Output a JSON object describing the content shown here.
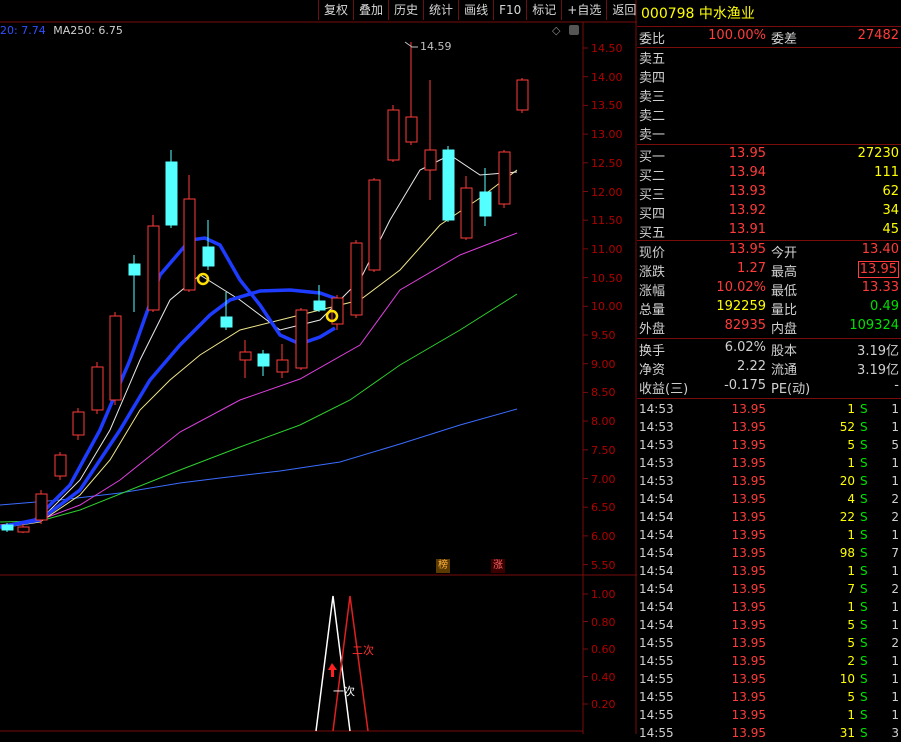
{
  "toolbar": [
    "复权",
    "叠加",
    "历史",
    "统计",
    "画线",
    "F10",
    "标记",
    "+自选",
    "返回"
  ],
  "indicator": {
    "ma_left": "20: 7.74",
    "ma250": "MA250: 6.75"
  },
  "price_axis": [
    "14.50",
    "14.00",
    "13.50",
    "13.00",
    "12.50",
    "12.00",
    "11.50",
    "11.00",
    "10.50",
    "10.00",
    "9.50",
    "9.00",
    "8.50",
    "8.00",
    "7.50",
    "7.00",
    "6.50",
    "6.00",
    "5.50"
  ],
  "peak_label": "14.59",
  "sub_axis": [
    "1.00",
    "0.80",
    "0.60",
    "0.40",
    "0.20"
  ],
  "badges": {
    "b1": "榜",
    "b2": "涨"
  },
  "signal_labels": {
    "first": "一次",
    "second": "二次"
  },
  "stock": {
    "code": "000798",
    "name": "中水渔业"
  },
  "weibi": {
    "label1": "委比",
    "value1": "100.00%",
    "label2": "委差",
    "value2": "27482"
  },
  "sell": [
    "卖五",
    "卖四",
    "卖三",
    "卖二",
    "卖一"
  ],
  "buy": [
    {
      "label": "买一",
      "price": "13.95",
      "vol": "27230"
    },
    {
      "label": "买二",
      "price": "13.94",
      "vol": "111"
    },
    {
      "label": "买三",
      "price": "13.93",
      "vol": "62"
    },
    {
      "label": "买四",
      "price": "13.92",
      "vol": "34"
    },
    {
      "label": "买五",
      "price": "13.91",
      "vol": "45"
    }
  ],
  "quote": [
    {
      "l1": "现价",
      "v1": "13.95",
      "l2": "今开",
      "v2": "13.40"
    },
    {
      "l1": "涨跌",
      "v1": "1.27",
      "l2": "最高",
      "v2": "13.95"
    },
    {
      "l1": "涨幅",
      "v1": "10.02%",
      "l2": "最低",
      "v2": "13.33"
    },
    {
      "l1": "总量",
      "v1": "192259",
      "l2": "量比",
      "v2": "0.49"
    },
    {
      "l1": "外盘",
      "v1": "82935",
      "l2": "内盘",
      "v2": "109324"
    }
  ],
  "fund": [
    {
      "l1": "换手",
      "v1": "6.02%",
      "l2": "股本",
      "v2": "3.19亿"
    },
    {
      "l1": "净资",
      "v1": "2.22",
      "l2": "流通",
      "v2": "3.19亿"
    },
    {
      "l1": "收益(三)",
      "v1": "-0.175",
      "l2": "PE(动)",
      "v2": "-"
    }
  ],
  "trades": [
    {
      "t": "14:53",
      "p": "13.95",
      "v": "1",
      "s": "S",
      "n": "1"
    },
    {
      "t": "14:53",
      "p": "13.95",
      "v": "52",
      "s": "S",
      "n": "1"
    },
    {
      "t": "14:53",
      "p": "13.95",
      "v": "5",
      "s": "S",
      "n": "5"
    },
    {
      "t": "14:53",
      "p": "13.95",
      "v": "1",
      "s": "S",
      "n": "1"
    },
    {
      "t": "14:53",
      "p": "13.95",
      "v": "20",
      "s": "S",
      "n": "1"
    },
    {
      "t": "14:54",
      "p": "13.95",
      "v": "4",
      "s": "S",
      "n": "2"
    },
    {
      "t": "14:54",
      "p": "13.95",
      "v": "22",
      "s": "S",
      "n": "2"
    },
    {
      "t": "14:54",
      "p": "13.95",
      "v": "1",
      "s": "S",
      "n": "1"
    },
    {
      "t": "14:54",
      "p": "13.95",
      "v": "98",
      "s": "S",
      "n": "7"
    },
    {
      "t": "14:54",
      "p": "13.95",
      "v": "1",
      "s": "S",
      "n": "1"
    },
    {
      "t": "14:54",
      "p": "13.95",
      "v": "7",
      "s": "S",
      "n": "2"
    },
    {
      "t": "14:54",
      "p": "13.95",
      "v": "1",
      "s": "S",
      "n": "1"
    },
    {
      "t": "14:54",
      "p": "13.95",
      "v": "5",
      "s": "S",
      "n": "1"
    },
    {
      "t": "14:55",
      "p": "13.95",
      "v": "5",
      "s": "S",
      "n": "2"
    },
    {
      "t": "14:55",
      "p": "13.95",
      "v": "2",
      "s": "S",
      "n": "1"
    },
    {
      "t": "14:55",
      "p": "13.95",
      "v": "10",
      "s": "S",
      "n": "1"
    },
    {
      "t": "14:55",
      "p": "13.95",
      "v": "5",
      "s": "S",
      "n": "1"
    },
    {
      "t": "14:55",
      "p": "13.95",
      "v": "1",
      "s": "S",
      "n": "1"
    },
    {
      "t": "14:55",
      "p": "13.95",
      "v": "31",
      "s": "S",
      "n": "3"
    }
  ],
  "colors": {
    "up": "#ff3b3b",
    "down": "#54ffff",
    "frame": "#7a0c0c",
    "ma_main": "#1e3cff"
  }
}
